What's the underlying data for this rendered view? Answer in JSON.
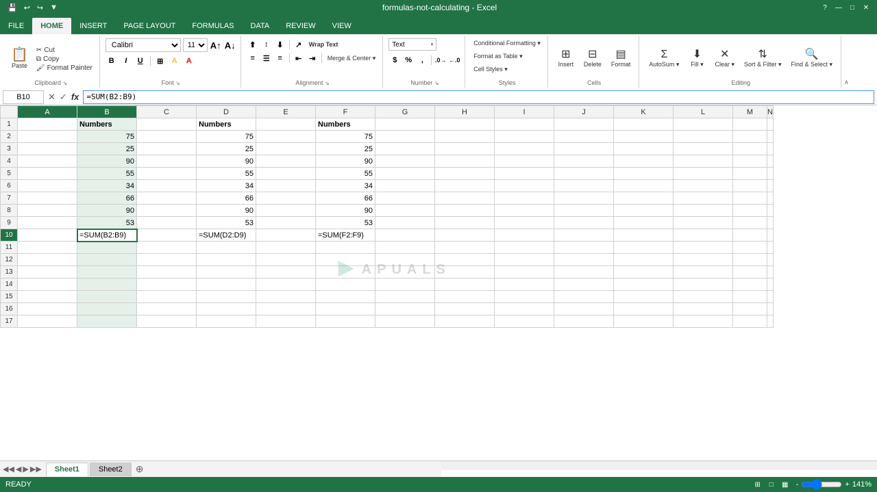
{
  "titleBar": {
    "title": "formulas-not-calculating - Excel",
    "quickAccess": [
      "💾",
      "↩",
      "↪",
      "▼"
    ]
  },
  "ribbon": {
    "tabs": [
      "FILE",
      "HOME",
      "INSERT",
      "PAGE LAYOUT",
      "FORMULAS",
      "DATA",
      "REVIEW",
      "VIEW"
    ],
    "activeTab": "HOME",
    "groups": {
      "clipboard": {
        "label": "Clipboard",
        "paste": "Paste",
        "cut": "✂ Cut",
        "copy": "📋 Copy",
        "formatPainter": "🖌 Format Painter"
      },
      "font": {
        "label": "Font",
        "fontName": "Calibri",
        "fontSize": "11"
      },
      "alignment": {
        "label": "Alignment",
        "wrapText": "Wrap Text",
        "mergeCenter": "Merge & Center ▾"
      },
      "number": {
        "label": "Number",
        "format": "Text"
      },
      "styles": {
        "label": "Styles",
        "conditional": "Conditional Formatting ▾",
        "formatAsTable": "Format as Table ▾",
        "cellStyles": "Cell Styles ▾"
      },
      "cells": {
        "label": "Cells",
        "insert": "Insert",
        "delete": "Delete",
        "format": "Format"
      },
      "editing": {
        "label": "Editing",
        "autoSum": "AutoSum ▾",
        "fill": "Fill ▾",
        "clear": "Clear ▾",
        "sortFilter": "Sort & Filter ▾",
        "findSelect": "Find & Select ▾"
      }
    }
  },
  "formulaBar": {
    "cellRef": "B10",
    "formula": "=SUM(B2:B9)",
    "cancelIcon": "✕",
    "confirmIcon": "✓",
    "formulaIcon": "fx"
  },
  "grid": {
    "columns": [
      "A",
      "B",
      "C",
      "D",
      "E",
      "F",
      "G",
      "H",
      "I",
      "J",
      "K",
      "L",
      "M",
      "N"
    ],
    "activeCell": "B10",
    "activeCol": "B",
    "activeRow": 10,
    "rows": [
      {
        "row": 1,
        "cells": {
          "B": "Numbers",
          "D": "Numbers",
          "F": "Numbers"
        }
      },
      {
        "row": 2,
        "cells": {
          "B": "75",
          "D": "75",
          "F": "75"
        }
      },
      {
        "row": 3,
        "cells": {
          "B": "25",
          "D": "25",
          "F": "25"
        }
      },
      {
        "row": 4,
        "cells": {
          "B": "90",
          "D": "90",
          "F": "90"
        }
      },
      {
        "row": 5,
        "cells": {
          "B": "55",
          "D": "55",
          "F": "55"
        }
      },
      {
        "row": 6,
        "cells": {
          "B": "34",
          "D": "34",
          "F": "34"
        }
      },
      {
        "row": 7,
        "cells": {
          "B": "66",
          "D": "66",
          "F": "66"
        }
      },
      {
        "row": 8,
        "cells": {
          "B": "90",
          "D": "90",
          "F": "90"
        }
      },
      {
        "row": 9,
        "cells": {
          "B": "53",
          "D": "53",
          "F": "53"
        }
      },
      {
        "row": 10,
        "cells": {
          "B": "=SUM(B2:B9)",
          "D": "=SUM(D2:D9)",
          "F": "=SUM(F2:F9)"
        }
      },
      {
        "row": 11,
        "cells": {}
      },
      {
        "row": 12,
        "cells": {}
      },
      {
        "row": 13,
        "cells": {}
      },
      {
        "row": 14,
        "cells": {}
      },
      {
        "row": 15,
        "cells": {}
      },
      {
        "row": 16,
        "cells": {}
      },
      {
        "row": 17,
        "cells": {}
      }
    ]
  },
  "sheetTabs": {
    "tabs": [
      "Sheet1",
      "Sheet2"
    ],
    "activeTab": "Sheet1"
  },
  "statusBar": {
    "status": "READY",
    "zoom": "141%"
  }
}
